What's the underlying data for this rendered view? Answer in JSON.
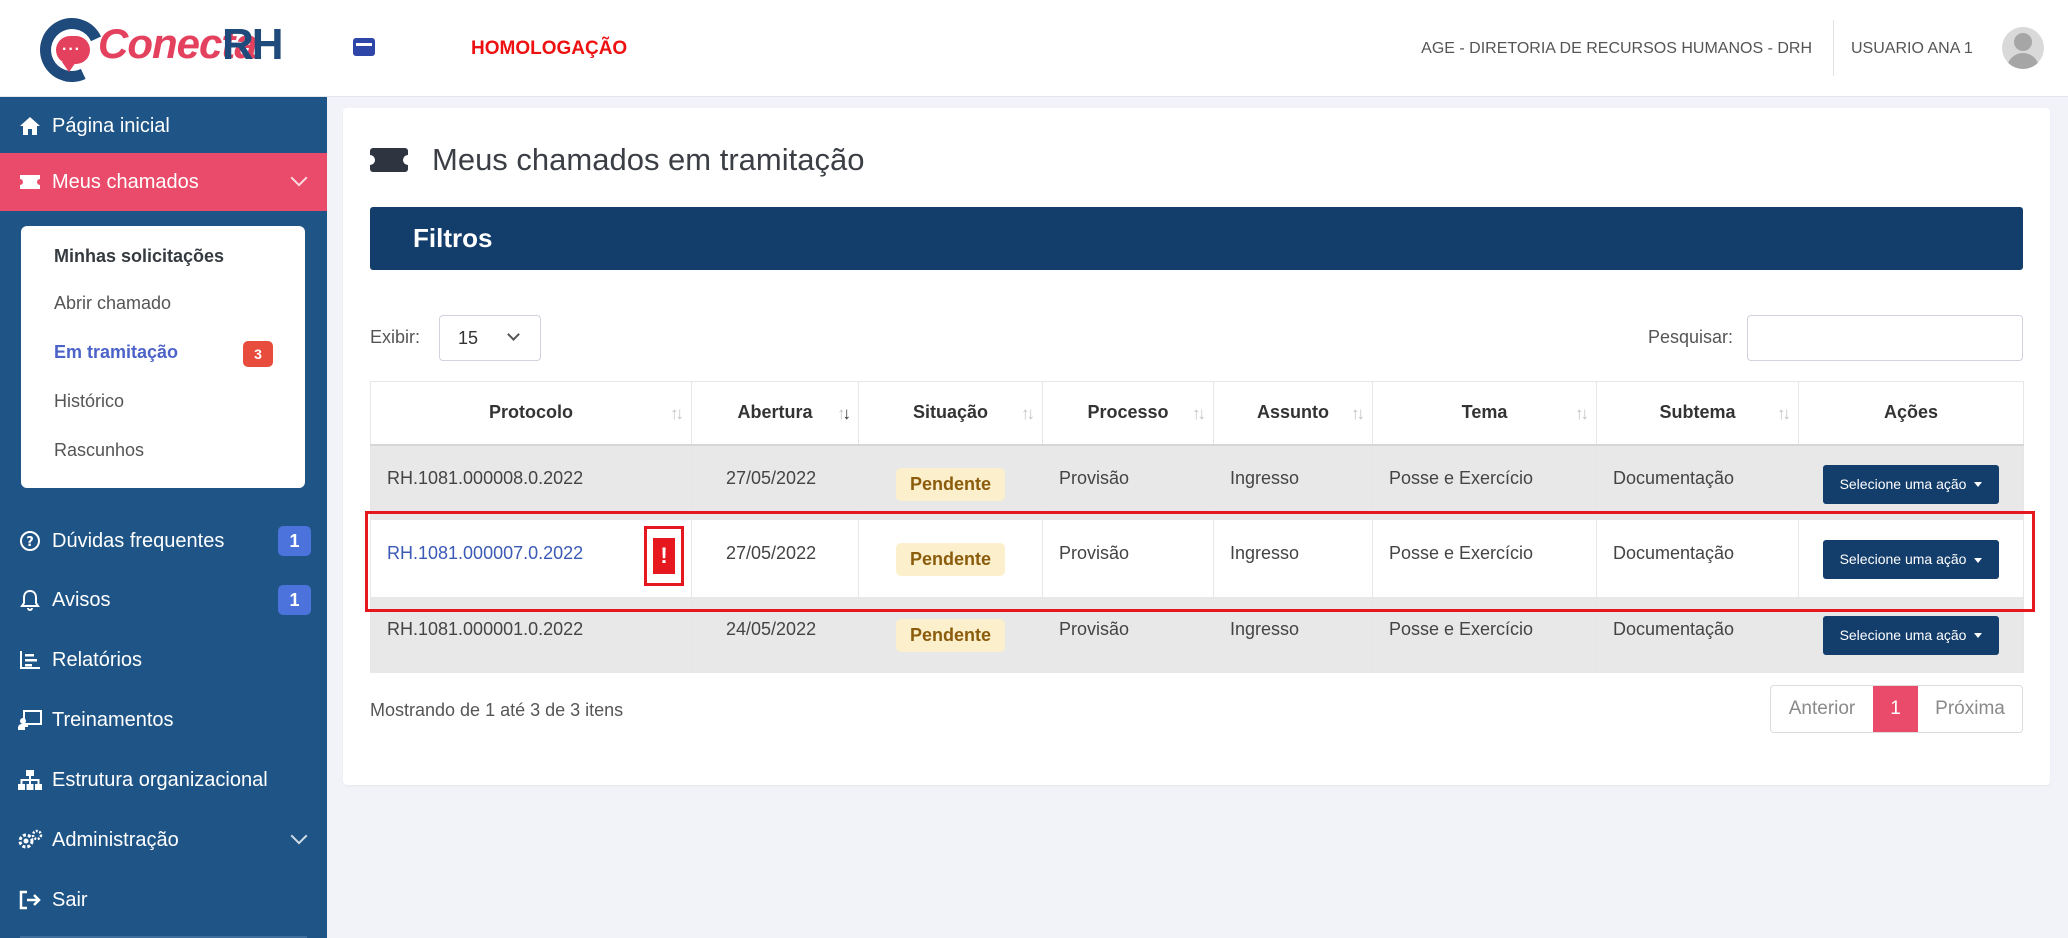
{
  "header": {
    "logo_text": "Conecta",
    "logo_text_rh": "RH",
    "environment": "HOMOLOGAÇÃO",
    "organization": "AGE - DIRETORIA DE RECURSOS HUMANOS - DRH",
    "user": "USUARIO ANA 1"
  },
  "sidebar": {
    "items": [
      {
        "label": "Página inicial",
        "icon": "home-icon"
      },
      {
        "label": "Meus chamados",
        "icon": "ticket-icon",
        "active": true
      },
      {
        "label": "Dúvidas frequentes",
        "icon": "question-circle-icon",
        "badge": "1"
      },
      {
        "label": "Avisos",
        "icon": "bell-icon",
        "badge": "1"
      },
      {
        "label": "Relatórios",
        "icon": "chart-icon"
      },
      {
        "label": "Treinamentos",
        "icon": "presentation-icon"
      },
      {
        "label": "Estrutura organizacional",
        "icon": "sitemap-icon"
      },
      {
        "label": "Administração",
        "icon": "cogs-icon"
      },
      {
        "label": "Sair",
        "icon": "sign-out-icon"
      }
    ],
    "submenu": [
      {
        "label": "Minhas solicitações"
      },
      {
        "label": "Abrir chamado"
      },
      {
        "label": "Em tramitação",
        "badge": "3"
      },
      {
        "label": "Histórico"
      },
      {
        "label": "Rascunhos"
      }
    ]
  },
  "main": {
    "title": "Meus chamados em tramitação",
    "filters_label": "Filtros",
    "show_label": "Exibir:",
    "show_value": "15",
    "search_label": "Pesquisar:",
    "search_value": "",
    "table": {
      "columns": [
        "Protocolo",
        "Abertura",
        "Situação",
        "Processo",
        "Assunto",
        "Tema",
        "Subtema",
        "Ações"
      ],
      "rows": [
        {
          "protocolo": "RH.1081.000008.0.2022",
          "abertura": "27/05/2022",
          "situacao": "Pendente",
          "processo": "Provisão",
          "assunto": "Ingresso",
          "tema": "Posse e Exercício",
          "subtema": "Documentação",
          "acao": "Selecione uma ação"
        },
        {
          "protocolo": "RH.1081.000007.0.2022",
          "abertura": "27/05/2022",
          "situacao": "Pendente",
          "processo": "Provisão",
          "assunto": "Ingresso",
          "tema": "Posse e Exercício",
          "subtema": "Documentação",
          "acao": "Selecione uma ação",
          "alert": "!"
        },
        {
          "protocolo": "RH.1081.000001.0.2022",
          "abertura": "24/05/2022",
          "situacao": "Pendente",
          "processo": "Provisão",
          "assunto": "Ingresso",
          "tema": "Posse e Exercício",
          "subtema": "Documentação",
          "acao": "Selecione uma ação"
        }
      ]
    },
    "showing_text": "Mostrando de 1 até 3 de 3 itens",
    "pagination": {
      "prev": "Anterior",
      "current": "1",
      "next": "Próxima"
    }
  },
  "colors": {
    "sidebar_bg": "#1e5486",
    "accent": "#ea4b6a",
    "header_bar": "#133d6b",
    "highlight": "#e6171e"
  }
}
